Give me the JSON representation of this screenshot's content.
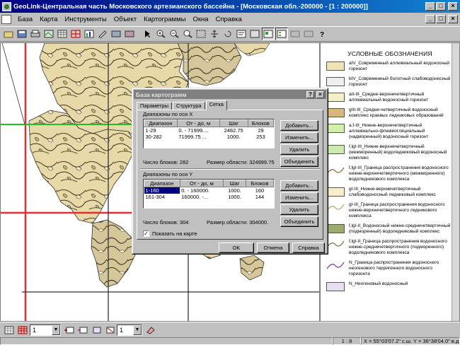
{
  "window": {
    "title": "GeoLink-Центральная часть Московского артезианского бассейна - [Московская обл.-200000 - [1 : 200000]]",
    "buttons": [
      "_",
      "□",
      "×"
    ],
    "mdi_buttons": [
      "_",
      "□",
      "×"
    ]
  },
  "menu": {
    "items": [
      {
        "label": "База",
        "accel": "Б"
      },
      {
        "label": "Карта",
        "accel": "К"
      },
      {
        "label": "Инструменты",
        "accel": "И"
      },
      {
        "label": "Объект",
        "accel": "О"
      },
      {
        "label": "Картограммы",
        "accel": "т"
      },
      {
        "label": "Окна",
        "accel": "О"
      },
      {
        "label": "Справка",
        "accel": "С"
      }
    ]
  },
  "toolbar": {
    "icons": [
      "open-icon",
      "save-icon",
      "print-icon",
      "layers-icon",
      "table-icon",
      "grid-icon",
      "chart-icon",
      "edit-icon",
      "export-icon",
      "import-icon",
      "pointer-icon",
      "zoom-in-icon",
      "zoom-out-icon",
      "zoom-window-icon",
      "zoom-extent-icon",
      "pan-icon",
      "refresh-icon",
      "info-icon",
      "select-icon",
      "map-view-icon",
      "legend-icon",
      "settings-icon",
      "copy-icon",
      "help-icon"
    ]
  },
  "legend": {
    "title": "УСЛОВНЫЕ ОБОЗНАЧЕНИЯ",
    "items": [
      {
        "color": "#f2e2b8",
        "text": "aIV_Современный аллювиальный водоносный горизонт"
      },
      {
        "color": "#f0f0f0",
        "text": "bIV_Современный болотный слабоводоносный горизонт"
      },
      {
        "color": "#f4f1c8",
        "text": "aII-III_Средне-верхнечетвертичный аллювиальный водоносный горизонт"
      },
      {
        "color": "#d8b87a",
        "text": "gIII-III_Средне-четвертичный водоносный комплекс краевых ледниковых образований"
      },
      {
        "color": "#d4f0a8",
        "text": "a,f-III_Нижне-верхнечетвертичный аллювиально-флювиогляциальный (надморенный) водоносный горизонт"
      },
      {
        "color": "#cdebb0",
        "text": "f,lgI-III_Нижне-верхнечетвертичный (межморенный) водоледниковый водоносный комплекс"
      },
      {
        "color": "line-brown",
        "text": "f,lgI-III_Граница распространения водоносного нижне-верхнечетвертичного (межморенного) водоледникового комплекса"
      },
      {
        "color": "#f6efc9",
        "text": "gI-III_Нижне-верхнечетвертичный слабоводоносный ледниковый комплекс"
      },
      {
        "color": "line-tan",
        "text": "gI-III_Граница распространения водоносного нижне-верхнечетвертичного ледникового комплекса"
      },
      {
        "color": "#9caa6e",
        "text": "f,lgI-II_Водоносный нижне-среднечетвертичный (подморенный) водоледниковый комплекс"
      },
      {
        "color": "line-olive",
        "text": "f,lgI-II_Граница распространения водоносного нижне-среднечетвертичного (подморенного) водоледникового комплекса"
      },
      {
        "color": "line-purple",
        "text": "N_Граница распространения водоносного неогенового терригенного водоносного горизонта"
      },
      {
        "color": "#e8e0f0",
        "text": "N_Неогеновый водоносный"
      }
    ]
  },
  "dialog": {
    "title": "База картограмм",
    "tabs": [
      "Параметры",
      "Структура",
      "Сетка"
    ],
    "active_tab": "Сетка",
    "x_group": {
      "label": "Диапазоны по оси X",
      "columns": [
        "Диапазон",
        "От - до, м",
        "Шаг",
        "Блоков"
      ],
      "rows": [
        [
          "1-29",
          "0. - 71999....",
          "2482.75",
          "29"
        ],
        [
          "30-282",
          "71999.75 ...",
          "1000.",
          "253"
        ]
      ],
      "blocks_label": "Число блоков: 282",
      "area_label": "Размер области: 324999.75"
    },
    "y_group": {
      "label": "Диапазоны по оси Y",
      "columns": [
        "Диапазон",
        "От - до, м",
        "Шаг",
        "Блоков"
      ],
      "rows": [
        [
          "1-160",
          "0. - 160000.",
          "1000.",
          "160"
        ],
        [
          "161-304",
          "160000. -...",
          "1000.",
          "144"
        ]
      ],
      "blocks_label": "Число блоков:  304",
      "area_label": "Размер области: 304000."
    },
    "buttons": {
      "add": "Добавить...",
      "edit": "Изменить...",
      "delete": "Удалить",
      "merge": "Объединить"
    },
    "show_on_map": {
      "label": "Показать на карте",
      "checked": true
    },
    "footer": {
      "ok": "OK",
      "cancel": "Отмена",
      "help": "Справка"
    }
  },
  "bottom_toolbar": {
    "combo1": "1",
    "combo2": "1"
  },
  "status": {
    "scale": "1 : 8",
    "coords": "X = 55°03'07.2\" с.ш.  Y = 36°38'04.0\" в.д."
  }
}
